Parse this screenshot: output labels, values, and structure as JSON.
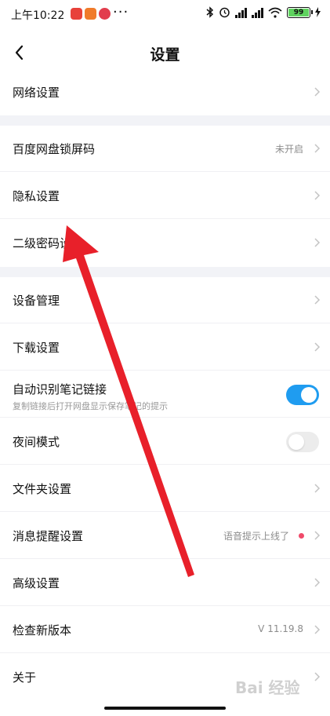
{
  "status_bar": {
    "time": "上午10:22",
    "dots": "···",
    "battery": "99"
  },
  "header": {
    "title": "设置"
  },
  "items": [
    {
      "label": "网络设置"
    },
    {
      "label": "百度网盘锁屏码",
      "value": "未开启"
    },
    {
      "label": "隐私设置"
    },
    {
      "label": "二级密码设"
    },
    {
      "label": "设备管理"
    },
    {
      "label": "下载设置"
    },
    {
      "label": "自动识别笔记链接",
      "sublabel": "复制链接后打开网盘显示保存笔记的提示",
      "toggle": "on"
    },
    {
      "label": "夜间模式",
      "toggle": "off"
    },
    {
      "label": "文件夹设置"
    },
    {
      "label": "消息提醒设置",
      "value": "语音提示上线了"
    },
    {
      "label": "高级设置"
    },
    {
      "label": "检查新版本",
      "value": "V 11.19.8"
    },
    {
      "label": "关于"
    }
  ],
  "watermark": "Bai 经验",
  "colors": {
    "accent": "#1f9cf0",
    "separator": "#f2f3f7",
    "arrow": "#e8202a",
    "notify_dot": "#f04a6a"
  }
}
